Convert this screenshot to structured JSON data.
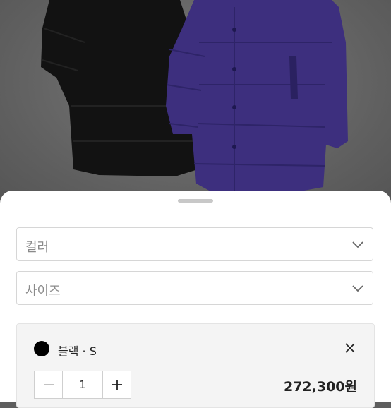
{
  "sheet": {
    "color_select": {
      "placeholder": "컬러"
    },
    "size_select": {
      "placeholder": "사이즈"
    },
    "selected_option": {
      "swatch_color": "#000000",
      "name": "블랙 · S",
      "quantity": "1",
      "price": "272,300원"
    }
  },
  "colors": {
    "coat_black": "#121212",
    "coat_purple": "#3d2f7e",
    "overlay": "#5e5e5e"
  }
}
